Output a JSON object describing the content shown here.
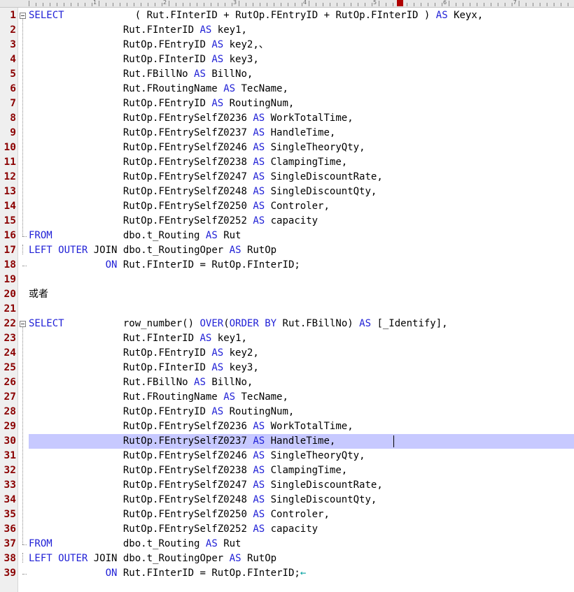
{
  "ruler": {
    "labels": [
      "1",
      "2",
      "3",
      "4",
      "5",
      "6",
      "7"
    ],
    "marker_column": 53
  },
  "editor": {
    "current_line": 30,
    "caret_after_line": 30,
    "eol_marker": "←",
    "keyword_color": "#1f1fd6",
    "line_number_color": "#8b0000",
    "current_line_color": "#c7c9ff",
    "lines": [
      "SELECT            ( Rut.FInterID + RutOp.FEntryID + RutOp.FInterID ) AS Keyx,",
      "                Rut.FInterID AS key1,",
      "                RutOp.FEntryID AS key2,、",
      "                RutOp.FInterID AS key3,",
      "                Rut.FBillNo AS BillNo,",
      "                Rut.FRoutingName AS TecName,",
      "                RutOp.FEntryID AS RoutingNum,",
      "                RutOp.FEntrySelfZ0236 AS WorkTotalTime,",
      "                RutOp.FEntrySelfZ0237 AS HandleTime,",
      "                RutOp.FEntrySelfZ0246 AS SingleTheoryQty,",
      "                RutOp.FEntrySelfZ0238 AS ClampingTime,",
      "                RutOp.FEntrySelfZ0247 AS SingleDiscountRate,",
      "                RutOp.FEntrySelfZ0248 AS SingleDiscountQty,",
      "                RutOp.FEntrySelfZ0250 AS Controler,",
      "                RutOp.FEntrySelfZ0252 AS capacity",
      "FROM            dbo.t_Routing AS Rut",
      "LEFT OUTER JOIN dbo.t_RoutingOper AS RutOp",
      "             ON Rut.FInterID = RutOp.FInterID;",
      "",
      "或者",
      "",
      "SELECT          row_number() OVER(ORDER BY Rut.FBillNo) AS [_Identify],",
      "                Rut.FInterID AS key1,",
      "                RutOp.FEntryID AS key2,",
      "                RutOp.FInterID AS key3,",
      "                Rut.FBillNo AS BillNo,",
      "                Rut.FRoutingName AS TecName,",
      "                RutOp.FEntryID AS RoutingNum,",
      "                RutOp.FEntrySelfZ0236 AS WorkTotalTime,",
      "                RutOp.FEntrySelfZ0237 AS HandleTime,",
      "                RutOp.FEntrySelfZ0246 AS SingleTheoryQty,",
      "                RutOp.FEntrySelfZ0238 AS ClampingTime,",
      "                RutOp.FEntrySelfZ0247 AS SingleDiscountRate,",
      "                RutOp.FEntrySelfZ0248 AS SingleDiscountQty,",
      "                RutOp.FEntrySelfZ0250 AS Controler,",
      "                RutOp.FEntrySelfZ0252 AS capacity",
      "FROM            dbo.t_Routing AS Rut",
      "LEFT OUTER JOIN dbo.t_RoutingOper AS RutOp",
      "             ON Rut.FInterID = RutOp.FInterID;"
    ],
    "folds": [
      {
        "start": 1,
        "end": 16
      },
      {
        "start": 22,
        "end": 37
      }
    ],
    "keywords": [
      "SELECT",
      "AS",
      "FROM",
      "LEFT",
      "OUTER",
      "ON",
      "OVER",
      "ORDER",
      "BY"
    ]
  }
}
